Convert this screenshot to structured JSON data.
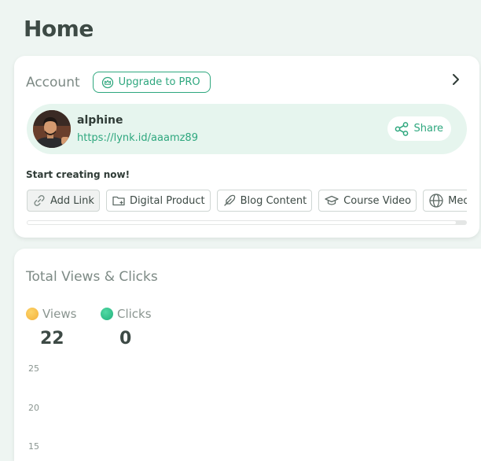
{
  "page": {
    "title": "Home"
  },
  "account": {
    "title": "Account",
    "upgrade_label": "Upgrade to PRO",
    "username": "alphine",
    "link": "https://lynk.id/aaamz89",
    "share_label": "Share"
  },
  "start_creating": {
    "label": "Start creating now!",
    "items": [
      {
        "label": "Add Link",
        "icon": "link-icon"
      },
      {
        "label": "Digital Product",
        "icon": "folder-plus-icon"
      },
      {
        "label": "Blog Content",
        "icon": "feather-icon"
      },
      {
        "label": "Course Video",
        "icon": "graduation-cap-icon"
      },
      {
        "label": "Media Kit",
        "icon": "globe-icon"
      }
    ]
  },
  "stats": {
    "title": "Total Views & Clicks",
    "views_label": "Views",
    "views_value": "22",
    "clicks_label": "Clicks",
    "clicks_value": "0",
    "views_color": "#f7bd3a",
    "clicks_color": "#2fbf8a"
  },
  "chart_data": {
    "type": "line",
    "title": "",
    "series": [
      {
        "name": "Views",
        "values": []
      },
      {
        "name": "Clicks",
        "values": []
      }
    ],
    "y_ticks": [
      "25",
      "20",
      "15"
    ]
  },
  "colors": {
    "accent": "#2ea77e",
    "background": "#eef5f2"
  }
}
